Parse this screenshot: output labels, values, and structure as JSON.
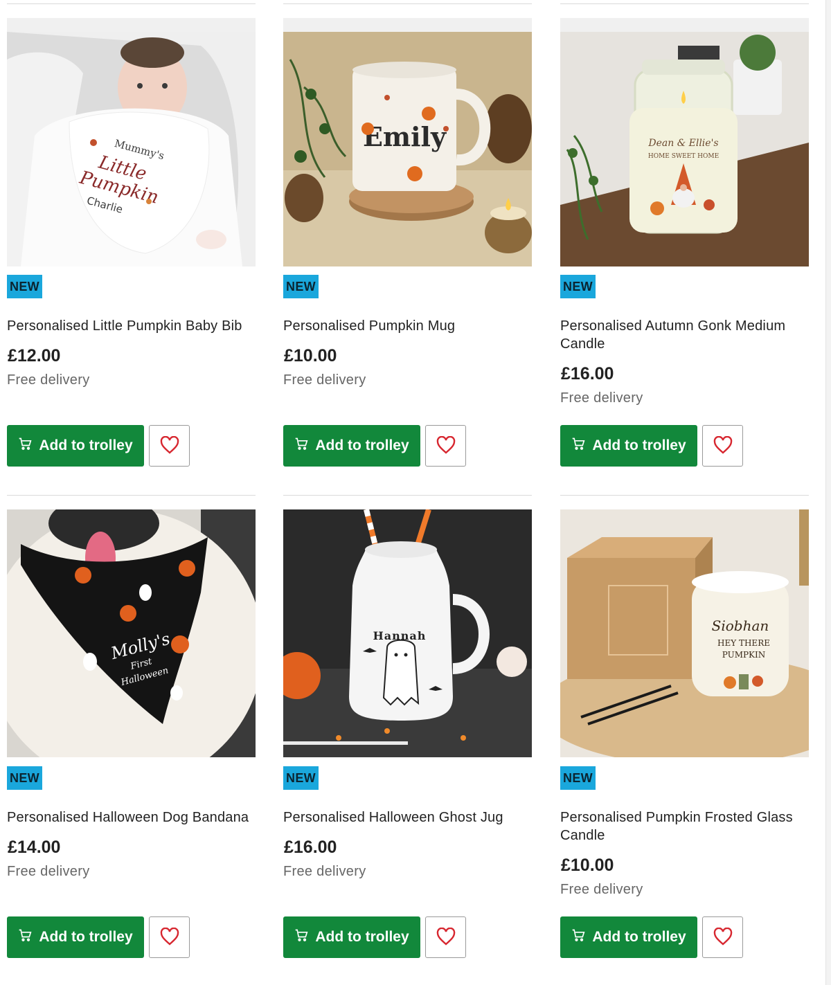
{
  "colors": {
    "accent_green": "#12883b",
    "badge_blue": "#1aa7dc",
    "favourite_red": "#d7262f"
  },
  "icons": {
    "trolley": "trolley-icon",
    "favourite": "heart-icon"
  },
  "products": [
    {
      "badge": "NEW",
      "title": "Personalised Little Pumpkin Baby Bib",
      "price": "£12.00",
      "delivery": "Free delivery",
      "add_label": "Add to trolley",
      "image_text": [
        "Mummy's",
        "Little",
        "Pumpkin",
        "Charlie"
      ]
    },
    {
      "badge": "NEW",
      "title": "Personalised Pumpkin Mug",
      "price": "£10.00",
      "delivery": "Free delivery",
      "add_label": "Add to trolley",
      "image_text": [
        "Emily"
      ]
    },
    {
      "badge": "NEW",
      "title": "Personalised Autumn Gonk Medium Candle",
      "price": "£16.00",
      "delivery": "Free delivery",
      "add_label": "Add to trolley",
      "image_text": [
        "Dean & Ellie's",
        "HOME SWEET HOME"
      ]
    },
    {
      "badge": "NEW",
      "title": "Personalised Halloween Dog Bandana",
      "price": "£14.00",
      "delivery": "Free delivery",
      "add_label": "Add to trolley",
      "image_text": [
        "Molly's",
        "First",
        "Halloween"
      ]
    },
    {
      "badge": "NEW",
      "title": "Personalised Halloween Ghost Jug",
      "price": "£16.00",
      "delivery": "Free delivery",
      "add_label": "Add to trolley",
      "image_text": [
        "Hannah"
      ]
    },
    {
      "badge": "NEW",
      "title": "Personalised Pumpkin Frosted Glass Candle",
      "price": "£10.00",
      "delivery": "Free delivery",
      "add_label": "Add to trolley",
      "image_text": [
        "Siobhan",
        "HEY THERE",
        "PUMPKIN"
      ]
    }
  ]
}
